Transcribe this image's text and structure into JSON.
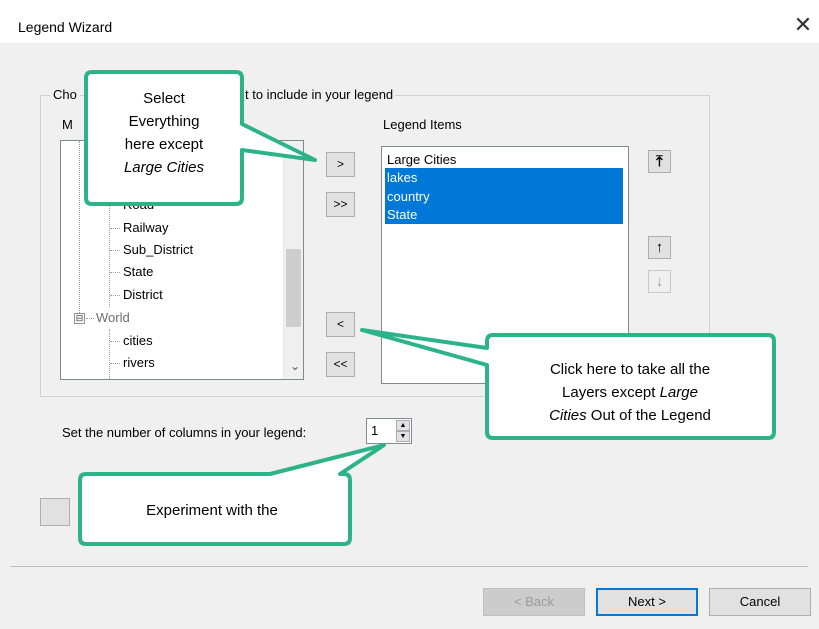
{
  "window": {
    "title": "Legend Wizard",
    "close_glyph": "✕"
  },
  "group": {
    "label_visible": "Cho",
    "label_visible_end": "t to include in your legend"
  },
  "map_layers": {
    "label": "M",
    "items": [
      {
        "text": "Road",
        "level": 2
      },
      {
        "text": "Railway",
        "level": 2
      },
      {
        "text": "Sub_District",
        "level": 2
      },
      {
        "text": "State",
        "level": 2
      },
      {
        "text": "District",
        "level": 2
      },
      {
        "text": "World",
        "level": 1,
        "expander": "⊟"
      },
      {
        "text": "cities",
        "level": 2
      },
      {
        "text": "rivers",
        "level": 2
      }
    ],
    "scroll_down_glyph": "⌄"
  },
  "transfer_buttons": {
    "add_one": ">",
    "add_all": ">>",
    "remove_one": "<",
    "remove_all": "<<"
  },
  "legend_items": {
    "label": "Legend Items",
    "items": [
      {
        "text": "Large Cities",
        "selected": false
      },
      {
        "text": "lakes",
        "selected": true
      },
      {
        "text": "country",
        "selected": true
      },
      {
        "text": "State",
        "selected": true
      }
    ]
  },
  "order_buttons": {
    "move_top_glyph": "⤒",
    "move_up_glyph": "↑",
    "move_down_glyph": "↓"
  },
  "columns": {
    "label": "Set the number of columns in your legend:",
    "value": "1"
  },
  "footer": {
    "back": "< Back",
    "next": "Next >",
    "cancel": "Cancel"
  },
  "callouts": {
    "select": {
      "line1": "Select",
      "line2": "Everything",
      "line3": "here except",
      "line4": "Large Cities"
    },
    "remove": {
      "line1": "Click here to take all the",
      "line2a": "Layers except ",
      "line2b": "Large",
      "line3a": "Cities",
      "line3b": " Out of the Legend"
    },
    "experiment": {
      "text": "Experiment with the"
    }
  },
  "colors": {
    "selection": "#0078d7",
    "callout_fill": "#ffffff",
    "callout_stroke": "#2db38a",
    "dialog_bg": "#f0f0f0"
  }
}
